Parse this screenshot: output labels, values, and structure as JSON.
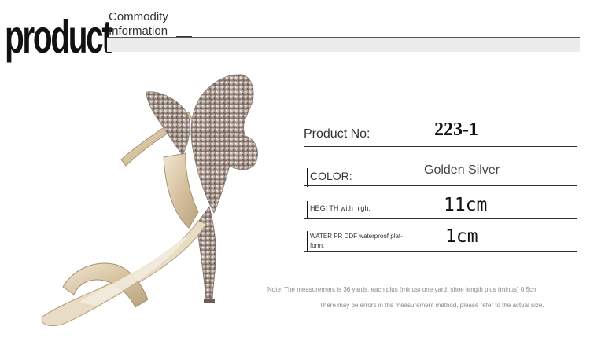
{
  "logo": {
    "text": "product"
  },
  "header": {
    "line1": "Commodity",
    "line2": "Information"
  },
  "specs": {
    "product_no": {
      "label": "Product No:",
      "value": "223-1"
    },
    "color": {
      "label": "COLOR:",
      "value": "Golden Silver"
    },
    "height": {
      "label": "HEGI TH with high:",
      "value": "11cm"
    },
    "platform": {
      "label_line1": "WATER PR DDF waterproof plat-",
      "label_line2": "form:",
      "value": "1cm"
    }
  },
  "notes": {
    "line1": "Note: The measurement is 36 yards, each plus (minus) one yard, shoe length plus (minus) 0.5cm",
    "line2": "There may be errors in the measurement method, please refer to the actual size."
  },
  "colors": {
    "shoe_gold": "#d8c6a4",
    "sparkle": "#b8a8a0",
    "text": "#333333"
  },
  "image": {
    "subject": "shoe-photo"
  }
}
